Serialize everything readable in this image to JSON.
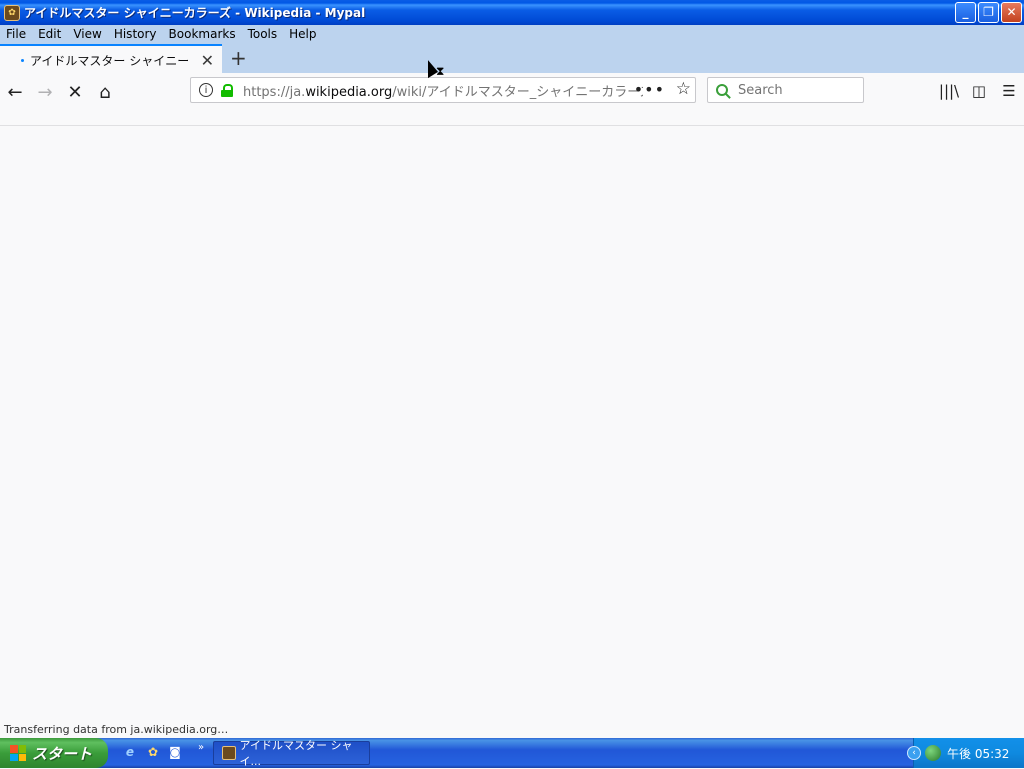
{
  "window": {
    "title": "アイドルマスター シャイニーカラーズ - Wikipedia - Mypal",
    "buttons": {
      "minimize": "_",
      "restore": "❐",
      "close": "✕"
    }
  },
  "menubar": {
    "items": [
      "File",
      "Edit",
      "View",
      "History",
      "Bookmarks",
      "Tools",
      "Help"
    ]
  },
  "tabs": [
    {
      "title": "アイドルマスター シャイニーカラーズ",
      "loading": true,
      "close": "✕"
    }
  ],
  "new_tab": "+",
  "toolbar": {
    "back": "←",
    "forward": "→",
    "stop": "✕",
    "home": "⌂",
    "url_prefix": "https://ja.",
    "url_host": "wikipedia.org",
    "url_path": "/wiki/アイドルマスター_シャイニーカラーズ",
    "page_actions": "•••",
    "bookmark_star": "☆",
    "search_placeholder": "Search",
    "library": "|||\\",
    "sidebar": "◫",
    "menu": "☰"
  },
  "status_text": "Transferring data from ja.wikipedia.org…",
  "taskbar": {
    "start_label": "スタート",
    "quick_launch": [
      {
        "name": "internet-explorer-icon",
        "glyph": "e"
      },
      {
        "name": "mypal-icon",
        "glyph": "✿"
      },
      {
        "name": "media-icon",
        "glyph": "◙"
      }
    ],
    "overflow": "»",
    "task_label": "アイドルマスター シャイ...",
    "clock": "午後 05:32",
    "tray_chevron": "‹"
  },
  "colors": {
    "title_bar": "#0a5de6",
    "tab_accent": "#0a84ff",
    "lock_green": "#12bc00",
    "start_green": "#3a9d3a",
    "taskbar_blue": "#2157d7"
  }
}
